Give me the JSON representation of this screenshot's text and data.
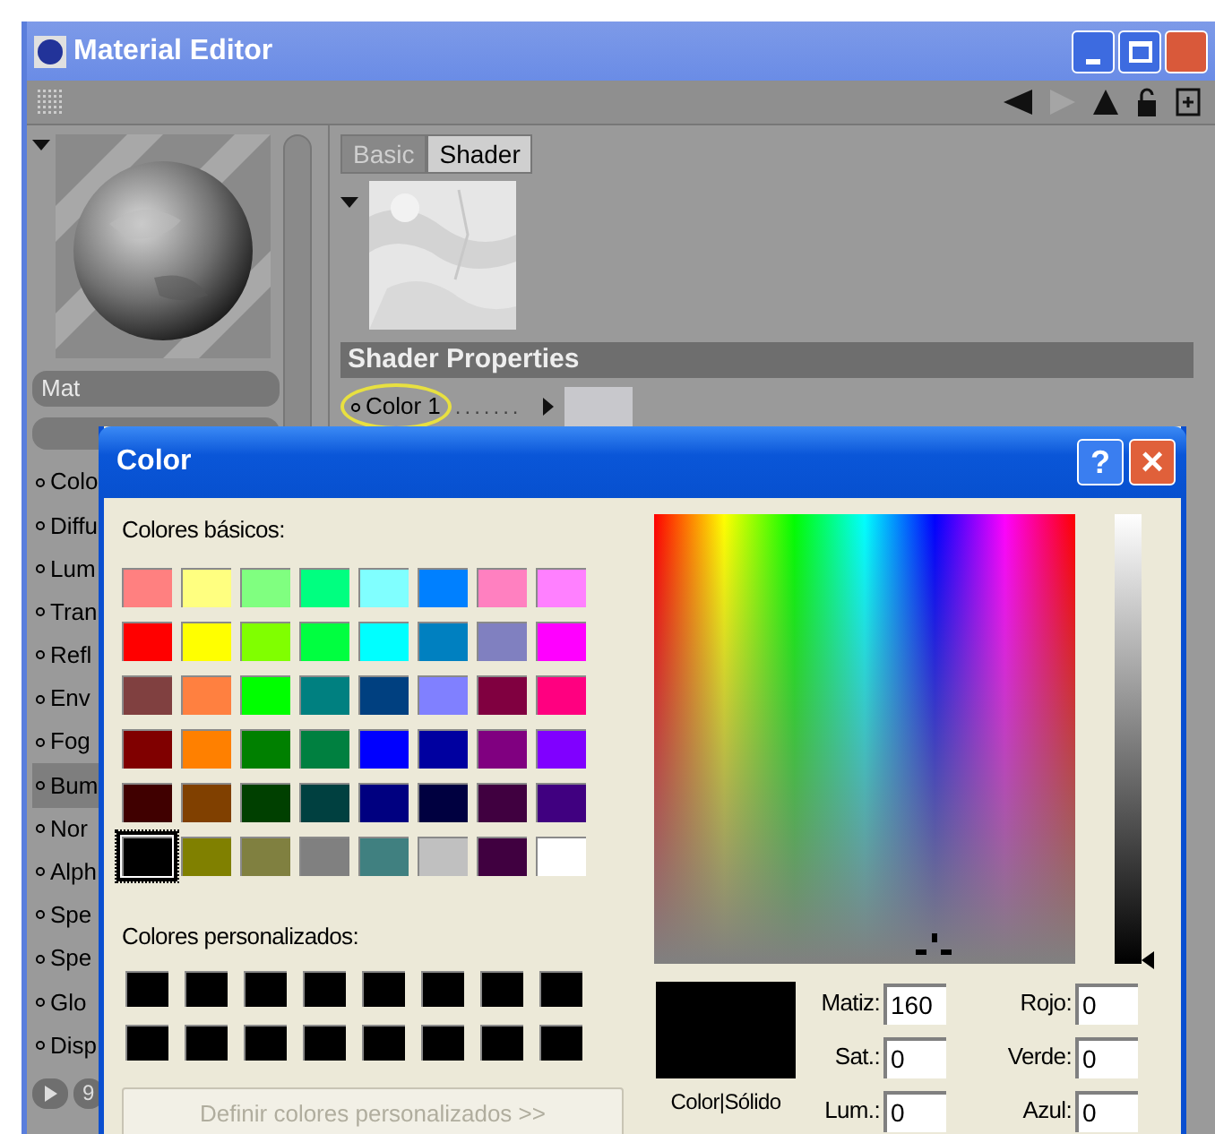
{
  "window": {
    "title": "Material Editor"
  },
  "material": {
    "name": "Mat",
    "channels": [
      {
        "label": "Colo",
        "selected": false
      },
      {
        "label": "Diffu",
        "selected": false
      },
      {
        "label": "Lum",
        "selected": false
      },
      {
        "label": "Tran",
        "selected": false
      },
      {
        "label": "Refl",
        "selected": false
      },
      {
        "label": "Env",
        "selected": false
      },
      {
        "label": "Fog",
        "selected": false
      },
      {
        "label": "Bum",
        "selected": true
      },
      {
        "label": "Nor",
        "selected": false
      },
      {
        "label": "Alph",
        "selected": false
      },
      {
        "label": "Spe",
        "selected": false
      },
      {
        "label": "Spe",
        "selected": false
      },
      {
        "label": "Glo",
        "selected": false
      },
      {
        "label": "Disp",
        "selected": false
      }
    ],
    "bottom_button": "9"
  },
  "tabs": [
    {
      "label": "Basic",
      "selected": false
    },
    {
      "label": "Shader",
      "selected": true
    }
  ],
  "shader_properties": {
    "heading": "Shader Properties",
    "property": {
      "label": "Color 1",
      "leader": ".......",
      "highlighted": true
    }
  },
  "color_dialog": {
    "title": "Color",
    "help_button": "?",
    "close_button": "×",
    "basic_label": "Colores básicos:",
    "basic_colors": [
      {
        "color": "#ff8080",
        "selected": false
      },
      {
        "color": "#ffff80",
        "selected": false
      },
      {
        "color": "#80ff80",
        "selected": false
      },
      {
        "color": "#00ff80",
        "selected": false
      },
      {
        "color": "#80ffff",
        "selected": false
      },
      {
        "color": "#0080ff",
        "selected": false
      },
      {
        "color": "#ff80c0",
        "selected": false
      },
      {
        "color": "#ff80ff",
        "selected": false
      },
      {
        "color": "#ff0000",
        "selected": false
      },
      {
        "color": "#ffff00",
        "selected": false
      },
      {
        "color": "#80ff00",
        "selected": false
      },
      {
        "color": "#00ff40",
        "selected": false
      },
      {
        "color": "#00ffff",
        "selected": false
      },
      {
        "color": "#0080c0",
        "selected": false
      },
      {
        "color": "#8080c0",
        "selected": false
      },
      {
        "color": "#ff00ff",
        "selected": false
      },
      {
        "color": "#804040",
        "selected": false
      },
      {
        "color": "#ff8040",
        "selected": false
      },
      {
        "color": "#00ff00",
        "selected": false
      },
      {
        "color": "#008080",
        "selected": false
      },
      {
        "color": "#004080",
        "selected": false
      },
      {
        "color": "#8080ff",
        "selected": false
      },
      {
        "color": "#800040",
        "selected": false
      },
      {
        "color": "#ff0080",
        "selected": false
      },
      {
        "color": "#800000",
        "selected": false
      },
      {
        "color": "#ff8000",
        "selected": false
      },
      {
        "color": "#008000",
        "selected": false
      },
      {
        "color": "#008040",
        "selected": false
      },
      {
        "color": "#0000ff",
        "selected": false
      },
      {
        "color": "#0000a0",
        "selected": false
      },
      {
        "color": "#800080",
        "selected": false
      },
      {
        "color": "#8000ff",
        "selected": false
      },
      {
        "color": "#400000",
        "selected": false
      },
      {
        "color": "#804000",
        "selected": false
      },
      {
        "color": "#004000",
        "selected": false
      },
      {
        "color": "#004040",
        "selected": false
      },
      {
        "color": "#000080",
        "selected": false
      },
      {
        "color": "#000040",
        "selected": false
      },
      {
        "color": "#400040",
        "selected": false
      },
      {
        "color": "#400080",
        "selected": false
      },
      {
        "color": "#000000",
        "selected": true
      },
      {
        "color": "#808000",
        "selected": false
      },
      {
        "color": "#808040",
        "selected": false
      },
      {
        "color": "#808080",
        "selected": false
      },
      {
        "color": "#408080",
        "selected": false
      },
      {
        "color": "#c0c0c0",
        "selected": false
      },
      {
        "color": "#400040",
        "selected": false
      },
      {
        "color": "#ffffff",
        "selected": false
      }
    ],
    "custom_label": "Colores personalizados:",
    "custom_colors": [
      {
        "color": "#000000"
      },
      {
        "color": "#000000"
      },
      {
        "color": "#000000"
      },
      {
        "color": "#000000"
      },
      {
        "color": "#000000"
      },
      {
        "color": "#000000"
      },
      {
        "color": "#000000"
      },
      {
        "color": "#000000"
      },
      {
        "color": "#000000"
      },
      {
        "color": "#000000"
      },
      {
        "color": "#000000"
      },
      {
        "color": "#000000"
      },
      {
        "color": "#000000"
      },
      {
        "color": "#000000"
      },
      {
        "color": "#000000"
      },
      {
        "color": "#000000"
      }
    ],
    "define_button": {
      "label": "Definir colores personalizados >>",
      "disabled": true
    },
    "preview": {
      "color": "#000000",
      "label": "Color|Sólido"
    },
    "hsl_fields": [
      {
        "label": "Matiz:",
        "value": "160"
      },
      {
        "label": "Sat.:",
        "value": "0"
      },
      {
        "label": "Lum.:",
        "value": "0"
      }
    ],
    "rgb_fields": [
      {
        "label": "Rojo:",
        "value": "0"
      },
      {
        "label": "Verde:",
        "value": "0"
      },
      {
        "label": "Azul:",
        "value": "0"
      }
    ]
  }
}
